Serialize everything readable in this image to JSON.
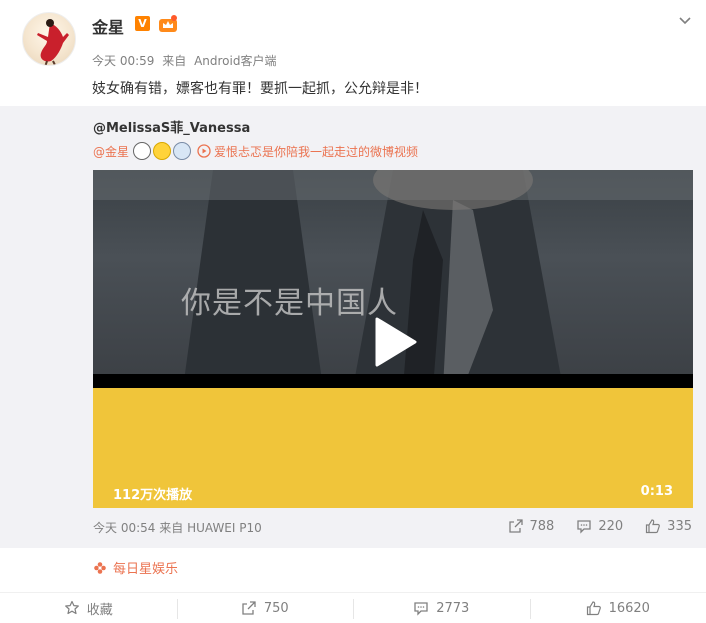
{
  "post": {
    "username": "金星",
    "verified_badge": "V",
    "time": "今天 00:59",
    "from_label": "来自",
    "client": "Android客户端",
    "text": "妓女确有错，嫖客也有罪！要抓一起抓，公允辩是非！",
    "menu_icon": "chevron-down-icon"
  },
  "repost": {
    "author": "@MelissaS菲_Vanessa",
    "mention": "@金星",
    "emojis": [
      "glasses-face-emoji",
      "thinking-face-emoji",
      "scared-face-emoji"
    ],
    "video_link": "爱恨忐忑是你陪我一起走过的微博视频",
    "video": {
      "subtitle": "你是不是中国人",
      "plays": "112万次播放",
      "duration": "0:13",
      "bar_color": "#f0c53a"
    },
    "time": "今天 00:54",
    "from_label": "来自",
    "client": "HUAWEI P10",
    "reposts": "788",
    "comments": "220",
    "likes": "335"
  },
  "source": {
    "label": "每日星娱乐",
    "icon": "pinwheel-icon"
  },
  "footer": {
    "favorite": "收藏",
    "reposts": "750",
    "comments": "2773",
    "likes": "16620"
  },
  "colors": {
    "accent": "#eb7350",
    "badge": "#ff8200",
    "muted": "#808080"
  }
}
